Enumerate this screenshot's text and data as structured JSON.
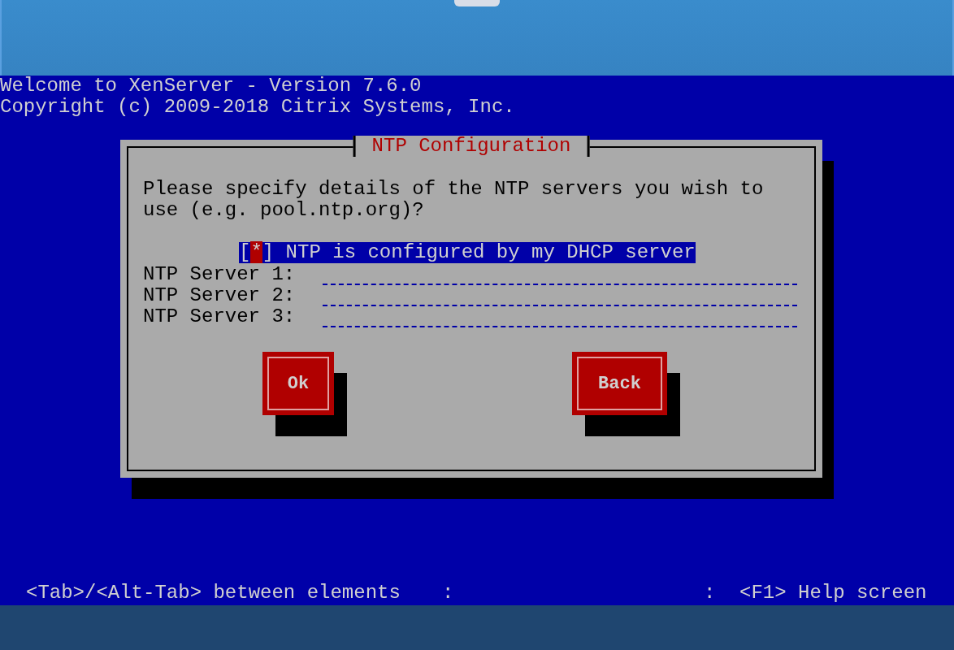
{
  "console": {
    "header_lines": [
      "Welcome to XenServer - Version 7.6.0",
      "Copyright (c) 2009-2018 Citrix Systems, Inc."
    ],
    "dialog": {
      "title": "NTP Configuration",
      "message_lines": [
        "Please specify details of the NTP servers you wish to",
        "use (e.g. pool.ntp.org)?"
      ],
      "checkbox": {
        "open_bracket": "[",
        "mark": "*",
        "close_bracket": "]",
        "label": "NTP is configured by my DHCP server",
        "checked": true,
        "focused": true
      },
      "servers": [
        {
          "label": "NTP Server 1:"
        },
        {
          "label": "NTP Server 2:"
        },
        {
          "label": "NTP Server 3:"
        }
      ],
      "buttons": [
        {
          "label": "Ok"
        },
        {
          "label": "Back"
        }
      ]
    },
    "status_bar": {
      "left": "<Tab>/<Alt-Tab> between elements",
      "separators": [
        ":",
        ":"
      ],
      "right": "<F1> Help screen"
    }
  }
}
